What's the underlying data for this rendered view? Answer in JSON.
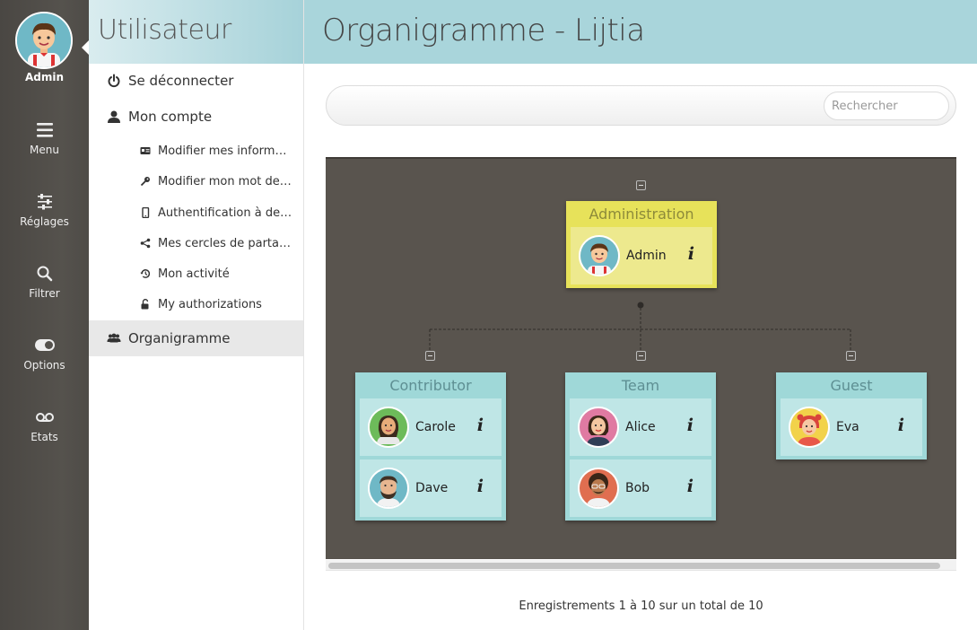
{
  "rail": {
    "user_label": "Admin",
    "items": [
      {
        "label": "Menu",
        "icon": "hamburger-icon"
      },
      {
        "label": "Réglages",
        "icon": "sliders-icon"
      },
      {
        "label": "Filtrer",
        "icon": "search-icon"
      },
      {
        "label": "Options",
        "icon": "toggle-icon"
      },
      {
        "label": "Etats",
        "icon": "voicemail-icon"
      }
    ]
  },
  "sidebar": {
    "title": "Utilisateur",
    "items": [
      {
        "label": "Se déconnecter",
        "icon": "power-icon"
      },
      {
        "label": "Mon compte",
        "icon": "user-icon"
      },
      {
        "label": "Modifier mes informat…",
        "icon": "id-card-icon"
      },
      {
        "label": "Modifier mon mot de …",
        "icon": "key-icon"
      },
      {
        "label": "Authentification à deu…",
        "icon": "mobile-icon"
      },
      {
        "label": "Mes cercles de partage",
        "icon": "share-icon"
      },
      {
        "label": "Mon activité",
        "icon": "history-icon"
      },
      {
        "label": "My authorizations",
        "icon": "unlock-icon"
      },
      {
        "label": "Organigramme",
        "icon": "users-icon"
      }
    ]
  },
  "header": {
    "title": "Organigramme - Lijtia"
  },
  "search": {
    "placeholder": "Rechercher",
    "value": ""
  },
  "org": {
    "root": {
      "title": "Administration",
      "members": [
        "Admin"
      ]
    },
    "children": [
      {
        "title": "Contributor",
        "members": [
          "Carole",
          "Dave"
        ]
      },
      {
        "title": "Team",
        "members": [
          "Alice",
          "Bob"
        ]
      },
      {
        "title": "Guest",
        "members": [
          "Eva"
        ]
      }
    ],
    "info_glyph": "i"
  },
  "footer": {
    "text": "Enregistrements 1 à 10 sur un total de 10"
  },
  "colors": {
    "rail": "#55524d",
    "header": "#a9d5db",
    "canvas": "#59544e",
    "admin_node": "#e7e25a",
    "group_node": "#9fd8d8"
  }
}
